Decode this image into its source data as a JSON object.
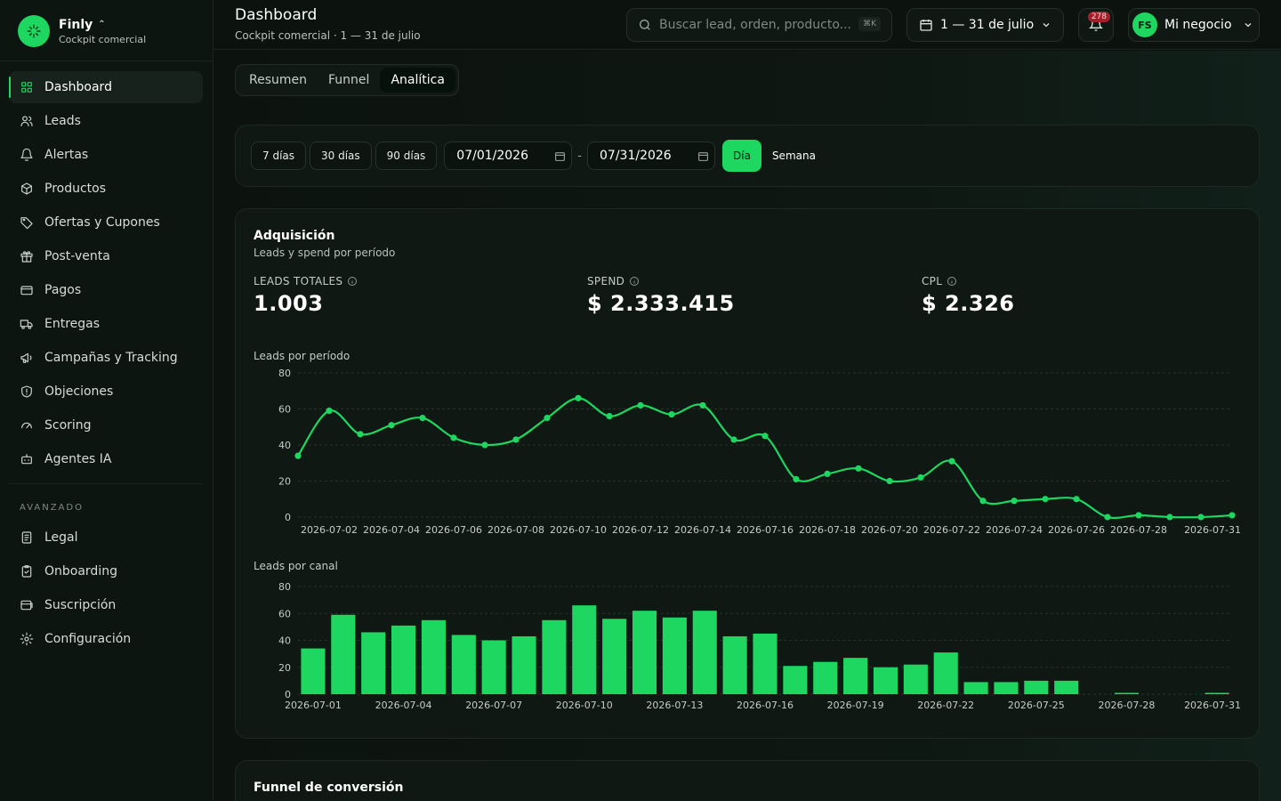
{
  "brand": {
    "name": "Finly",
    "subtitle": "Cockpit comercial"
  },
  "sidebar": {
    "items": [
      {
        "label": "Dashboard",
        "icon": "grid-icon"
      },
      {
        "label": "Leads",
        "icon": "users-icon"
      },
      {
        "label": "Alertas",
        "icon": "bell-icon"
      },
      {
        "label": "Productos",
        "icon": "box-icon"
      },
      {
        "label": "Ofertas y Cupones",
        "icon": "tag-icon"
      },
      {
        "label": "Post-venta",
        "icon": "gift-icon"
      },
      {
        "label": "Pagos",
        "icon": "wallet-icon"
      },
      {
        "label": "Entregas",
        "icon": "truck-icon"
      },
      {
        "label": "Campañas y Tracking",
        "icon": "megaphone-icon"
      },
      {
        "label": "Objeciones",
        "icon": "shield-icon"
      },
      {
        "label": "Scoring",
        "icon": "gauge-icon"
      },
      {
        "label": "Agentes IA",
        "icon": "bot-icon"
      }
    ],
    "section_label": "AVANZADO",
    "advanced_items": [
      {
        "label": "Legal",
        "icon": "document-icon"
      },
      {
        "label": "Onboarding",
        "icon": "clipboard-icon"
      },
      {
        "label": "Suscripción",
        "icon": "card-icon"
      },
      {
        "label": "Configuración",
        "icon": "gear-icon"
      }
    ]
  },
  "header": {
    "title": "Dashboard",
    "subtitle": "Cockpit comercial · 1 — 31 de julio",
    "search_placeholder": "Buscar lead, orden, producto...",
    "search_shortcut": "⌘K",
    "date_range": "1 — 31 de julio",
    "notifications": "278",
    "user_initials": "FS",
    "business": "Mi negocio"
  },
  "tabs": [
    "Resumen",
    "Funnel",
    "Analítica"
  ],
  "active_tab": "Analítica",
  "filters": {
    "presets": [
      "7 días",
      "30 días",
      "90 días"
    ],
    "date_from": "07/01/2026",
    "date_to": "07/31/2026",
    "separator": "-",
    "granularity": [
      "Día",
      "Semana"
    ],
    "active_granularity": "Día"
  },
  "acquisition": {
    "title": "Adquisición",
    "subtitle": "Leads y spend por período",
    "kpis": [
      {
        "label": "LEADS TOTALES",
        "value": "1.003"
      },
      {
        "label": "SPEND",
        "value": "$ 2.333.415"
      },
      {
        "label": "CPL",
        "value": "$ 2.326"
      }
    ],
    "line_chart_label": "Leads por período",
    "bar_chart_label": "Leads por canal"
  },
  "funnel": {
    "title": "Funnel de conversión"
  },
  "colors": {
    "accent": "#1ed760",
    "background": "#0c130f",
    "card": "#0f1813"
  },
  "chart_data": [
    {
      "type": "line",
      "title": "Leads por período",
      "x": [
        "2026-07-01",
        "2026-07-02",
        "2026-07-03",
        "2026-07-04",
        "2026-07-05",
        "2026-07-06",
        "2026-07-07",
        "2026-07-08",
        "2026-07-09",
        "2026-07-10",
        "2026-07-11",
        "2026-07-12",
        "2026-07-13",
        "2026-07-14",
        "2026-07-15",
        "2026-07-16",
        "2026-07-17",
        "2026-07-18",
        "2026-07-19",
        "2026-07-20",
        "2026-07-21",
        "2026-07-22",
        "2026-07-23",
        "2026-07-24",
        "2026-07-25",
        "2026-07-26",
        "2026-07-27",
        "2026-07-28",
        "2026-07-29",
        "2026-07-30",
        "2026-07-31"
      ],
      "x_tick_labels": [
        "2026-07-02",
        "2026-07-04",
        "2026-07-06",
        "2026-07-08",
        "2026-07-10",
        "2026-07-12",
        "2026-07-14",
        "2026-07-16",
        "2026-07-18",
        "2026-07-20",
        "2026-07-22",
        "2026-07-24",
        "2026-07-26",
        "2026-07-28",
        "2026-07-31"
      ],
      "y": [
        34,
        59,
        46,
        51,
        55,
        44,
        40,
        43,
        55,
        66,
        56,
        62,
        57,
        62,
        43,
        45,
        21,
        24,
        27,
        20,
        22,
        31,
        9,
        9,
        10,
        10,
        0,
        1,
        0,
        0,
        1
      ],
      "ylim": [
        0,
        80
      ],
      "yticks": [
        0,
        20,
        40,
        60,
        80
      ],
      "grid": true
    },
    {
      "type": "bar",
      "title": "Leads por canal",
      "categories": [
        "2026-07-01",
        "2026-07-02",
        "2026-07-03",
        "2026-07-04",
        "2026-07-05",
        "2026-07-06",
        "2026-07-07",
        "2026-07-08",
        "2026-07-09",
        "2026-07-10",
        "2026-07-11",
        "2026-07-12",
        "2026-07-13",
        "2026-07-14",
        "2026-07-15",
        "2026-07-16",
        "2026-07-17",
        "2026-07-18",
        "2026-07-19",
        "2026-07-20",
        "2026-07-21",
        "2026-07-22",
        "2026-07-23",
        "2026-07-24",
        "2026-07-25",
        "2026-07-26",
        "2026-07-27",
        "2026-07-28",
        "2026-07-29",
        "2026-07-30",
        "2026-07-31"
      ],
      "x_tick_labels": [
        "2026-07-01",
        "2026-07-04",
        "2026-07-07",
        "2026-07-10",
        "2026-07-13",
        "2026-07-16",
        "2026-07-19",
        "2026-07-22",
        "2026-07-25",
        "2026-07-28",
        "2026-07-31"
      ],
      "values": [
        34,
        59,
        46,
        51,
        55,
        44,
        40,
        43,
        55,
        66,
        56,
        62,
        57,
        62,
        43,
        45,
        21,
        24,
        27,
        20,
        22,
        31,
        9,
        9,
        10,
        10,
        0,
        1,
        0,
        0,
        1
      ],
      "ylim": [
        0,
        80
      ],
      "yticks": [
        0,
        20,
        40,
        60,
        80
      ],
      "grid": true
    }
  ]
}
